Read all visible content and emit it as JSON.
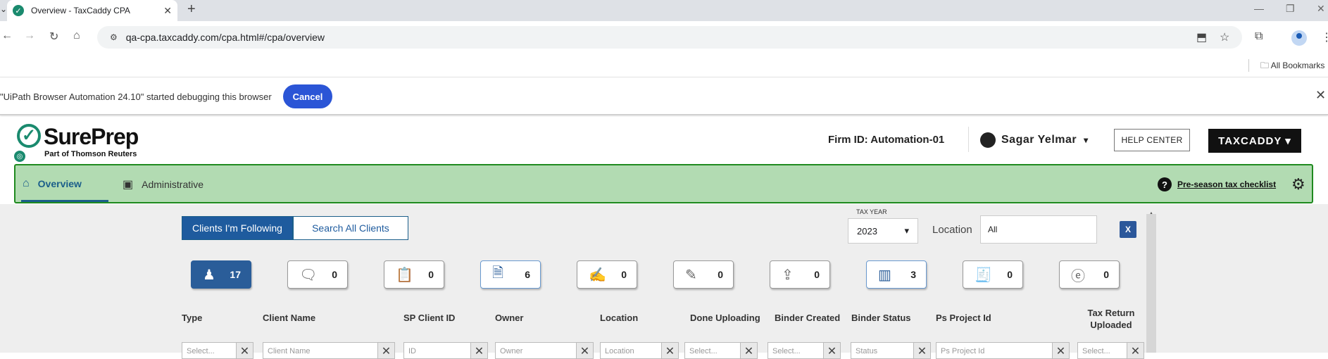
{
  "browser": {
    "tab_title": "Overview - TaxCaddy CPA",
    "url": "qa-cpa.taxcaddy.com/cpa.html#/cpa/overview",
    "bookmarks_label": "All Bookmarks"
  },
  "debug_bar": {
    "message": "\"UiPath Browser Automation 24.10\" started debugging this browser",
    "cancel_label": "Cancel"
  },
  "header": {
    "logo_brand": "SurePrep",
    "logo_sub": "Part of Thomson Reuters",
    "firm_id": "Firm ID: Automation-01",
    "user_name": "Sagar Yelmar",
    "help_label": "HELP CENTER",
    "taxcaddy_label": "TAXCADDY"
  },
  "nav": {
    "overview": "Overview",
    "administrative": "Administrative",
    "checklist": "Pre-season tax checklist"
  },
  "filters": {
    "following": "Clients I'm Following",
    "search_all": "Search All Clients",
    "tax_year_label": "TAX YEAR",
    "tax_year": "2023",
    "location_label": "Location",
    "location_value": "All"
  },
  "stats": [
    {
      "icon": "person-icon",
      "count": "17"
    },
    {
      "icon": "chat-icon",
      "count": "0"
    },
    {
      "icon": "clipboard-icon",
      "count": "0"
    },
    {
      "icon": "document-icon",
      "count": "6"
    },
    {
      "icon": "document-check-icon",
      "count": "0"
    },
    {
      "icon": "document-edit-icon",
      "count": "0"
    },
    {
      "icon": "binder-upload-icon",
      "count": "0"
    },
    {
      "icon": "binder-status-icon",
      "count": "3"
    },
    {
      "icon": "receipt-icon",
      "count": "0"
    },
    {
      "icon": "efile-icon",
      "count": "0"
    }
  ],
  "columns": [
    "Type",
    "Client Name",
    "SP Client ID",
    "Owner",
    "Location",
    "Done Uploading",
    "Binder Created",
    "Binder Status",
    "Ps Project Id",
    "Tax Return Uploaded"
  ],
  "column_filters": [
    "Select...",
    "Client Name",
    "ID",
    "Owner",
    "Location",
    "Select...",
    "Select...",
    "Status",
    "Ps Project Id",
    "Select..."
  ]
}
